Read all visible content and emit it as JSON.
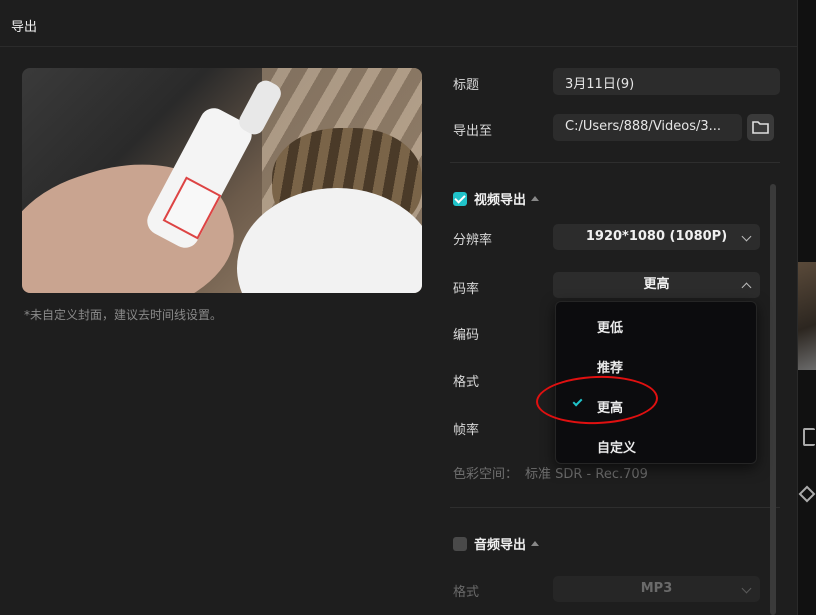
{
  "dialog": {
    "title": "导出",
    "cover_note": "*未自定义封面，建议去时间线设置。"
  },
  "fields": {
    "title_label": "标题",
    "title_value": "3月11日(9)",
    "export_to_label": "导出至",
    "export_to_value": "C:/Users/888/Videos/3..."
  },
  "video_export": {
    "label": "视频导出",
    "checked": true,
    "resolution_label": "分辨率",
    "resolution_value": "1920*1080 (1080P)",
    "bitrate_label": "码率",
    "bitrate_value": "更高",
    "codec_label": "编码",
    "format_label": "格式",
    "framerate_label": "帧率",
    "colorspace_label": "色彩空间：",
    "colorspace_value": "标准 SDR - Rec.709"
  },
  "bitrate_dropdown": {
    "options": [
      "更低",
      "推荐",
      "更高",
      "自定义"
    ],
    "selected": "更高"
  },
  "audio_export": {
    "label": "音频导出",
    "checked": false,
    "format_label": "格式",
    "format_value": "MP3"
  },
  "colors": {
    "accent": "#20c3c9",
    "annotation": "#e01010"
  }
}
